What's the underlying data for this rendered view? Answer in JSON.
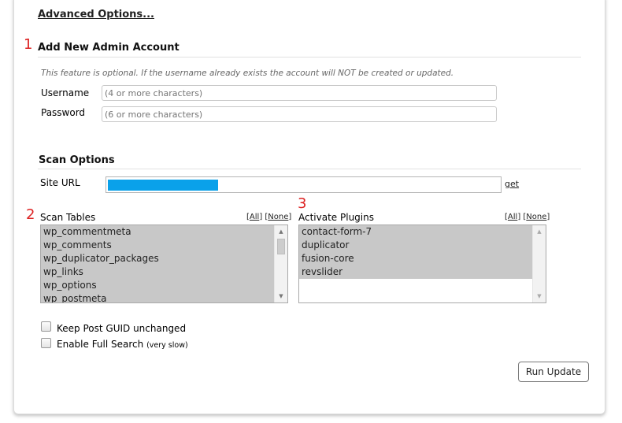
{
  "advanced_options_label": "Advanced Options...",
  "admin_section": {
    "step_number": "1",
    "title": "Add New Admin Account",
    "note": "This feature is optional. If the username already exists the account will NOT be created or updated.",
    "username_label": "Username",
    "username_placeholder": "(4 or more characters)",
    "password_label": "Password",
    "password_placeholder": "(6 or more characters)"
  },
  "scan_section": {
    "title": "Scan Options",
    "site_url_label": "Site URL",
    "site_url_value": "",
    "get_link": "get",
    "scan_tables": {
      "step_number": "2",
      "label": "Scan Tables",
      "all_link": "All",
      "none_link": "None",
      "items": [
        "wp_commentmeta",
        "wp_comments",
        "wp_duplicator_packages",
        "wp_links",
        "wp_options",
        "wp_postmeta"
      ]
    },
    "activate_plugins": {
      "step_number": "3",
      "label": "Activate Plugins",
      "all_link": "All",
      "none_link": "None",
      "items": [
        "contact-form-7",
        "duplicator",
        "fusion-core",
        "revslider"
      ]
    },
    "options": {
      "keep_guid_label": "Keep Post GUID unchanged",
      "full_search_label": "Enable Full Search",
      "full_search_note": "(very slow)"
    },
    "run_update_label": "Run Update"
  },
  "colors": {
    "step_number": "#dd2222",
    "url_redaction": "#0aa1ea",
    "selected_item_bg": "#c8c8c8"
  }
}
